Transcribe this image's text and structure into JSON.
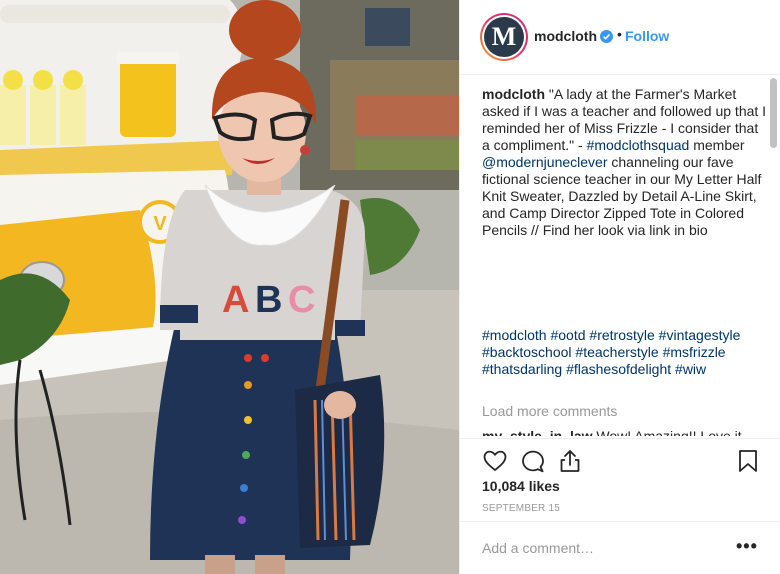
{
  "header": {
    "avatar_letter": "M",
    "username": "modcloth",
    "separator": "•",
    "follow_label": "Follow"
  },
  "caption": {
    "username": "modcloth",
    "text_1": " \"A lady at the Farmer's Market asked if I was a teacher and followed up that I reminded her of Miss Frizzle - I consider that a compliment.\" - ",
    "tag_1": "#modclothsquad",
    "text_2": " member ",
    "mention": "@modernjuneclever",
    "text_3": " channeling our fave fictional science teacher in our My Letter Half Knit Sweater, Dazzled by Detail A-Line Skirt, and Camp Director Zipped Tote in Colored Pencils // Find her look via link in bio"
  },
  "hashtags": [
    "#modcloth",
    "#ootd",
    "#retrostyle",
    "#vintagestyle",
    "#backtoschool",
    "#teacherstyle",
    "#msfrizzle",
    "#thatsdarling",
    "#flashesofdelight",
    "#wiw"
  ],
  "load_more_label": "Load more comments",
  "peek_comment": {
    "username": "my_style_in_law",
    "text": " Wow! Amazing!! Love it"
  },
  "likes": "10,084 likes",
  "date": "SEPTEMBER 15",
  "add_comment": {
    "placeholder": "Add a comment…",
    "more_label": "•••"
  },
  "photo": {
    "sweater_letters": [
      "A",
      "B",
      "C"
    ]
  },
  "icons": {
    "verified": "verified-badge-icon",
    "like": "heart-icon",
    "comment": "comment-bubble-icon",
    "share": "share-icon",
    "save": "bookmark-icon"
  },
  "colors": {
    "follow": "#3897f0",
    "link": "#003569",
    "muted": "#999999",
    "text": "#262626"
  }
}
